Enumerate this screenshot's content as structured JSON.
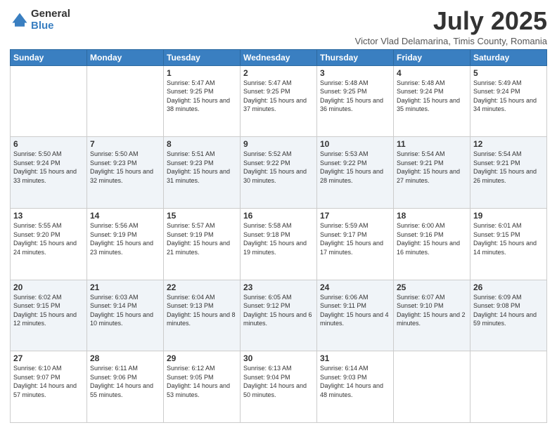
{
  "logo": {
    "general": "General",
    "blue": "Blue"
  },
  "title": "July 2025",
  "subtitle": "Victor Vlad Delamarina, Timis County, Romania",
  "days_of_week": [
    "Sunday",
    "Monday",
    "Tuesday",
    "Wednesday",
    "Thursday",
    "Friday",
    "Saturday"
  ],
  "weeks": [
    [
      {
        "day": "",
        "sunrise": "",
        "sunset": "",
        "daylight": ""
      },
      {
        "day": "",
        "sunrise": "",
        "sunset": "",
        "daylight": ""
      },
      {
        "day": "1",
        "sunrise": "Sunrise: 5:47 AM",
        "sunset": "Sunset: 9:25 PM",
        "daylight": "Daylight: 15 hours and 38 minutes."
      },
      {
        "day": "2",
        "sunrise": "Sunrise: 5:47 AM",
        "sunset": "Sunset: 9:25 PM",
        "daylight": "Daylight: 15 hours and 37 minutes."
      },
      {
        "day": "3",
        "sunrise": "Sunrise: 5:48 AM",
        "sunset": "Sunset: 9:25 PM",
        "daylight": "Daylight: 15 hours and 36 minutes."
      },
      {
        "day": "4",
        "sunrise": "Sunrise: 5:48 AM",
        "sunset": "Sunset: 9:24 PM",
        "daylight": "Daylight: 15 hours and 35 minutes."
      },
      {
        "day": "5",
        "sunrise": "Sunrise: 5:49 AM",
        "sunset": "Sunset: 9:24 PM",
        "daylight": "Daylight: 15 hours and 34 minutes."
      }
    ],
    [
      {
        "day": "6",
        "sunrise": "Sunrise: 5:50 AM",
        "sunset": "Sunset: 9:24 PM",
        "daylight": "Daylight: 15 hours and 33 minutes."
      },
      {
        "day": "7",
        "sunrise": "Sunrise: 5:50 AM",
        "sunset": "Sunset: 9:23 PM",
        "daylight": "Daylight: 15 hours and 32 minutes."
      },
      {
        "day": "8",
        "sunrise": "Sunrise: 5:51 AM",
        "sunset": "Sunset: 9:23 PM",
        "daylight": "Daylight: 15 hours and 31 minutes."
      },
      {
        "day": "9",
        "sunrise": "Sunrise: 5:52 AM",
        "sunset": "Sunset: 9:22 PM",
        "daylight": "Daylight: 15 hours and 30 minutes."
      },
      {
        "day": "10",
        "sunrise": "Sunrise: 5:53 AM",
        "sunset": "Sunset: 9:22 PM",
        "daylight": "Daylight: 15 hours and 28 minutes."
      },
      {
        "day": "11",
        "sunrise": "Sunrise: 5:54 AM",
        "sunset": "Sunset: 9:21 PM",
        "daylight": "Daylight: 15 hours and 27 minutes."
      },
      {
        "day": "12",
        "sunrise": "Sunrise: 5:54 AM",
        "sunset": "Sunset: 9:21 PM",
        "daylight": "Daylight: 15 hours and 26 minutes."
      }
    ],
    [
      {
        "day": "13",
        "sunrise": "Sunrise: 5:55 AM",
        "sunset": "Sunset: 9:20 PM",
        "daylight": "Daylight: 15 hours and 24 minutes."
      },
      {
        "day": "14",
        "sunrise": "Sunrise: 5:56 AM",
        "sunset": "Sunset: 9:19 PM",
        "daylight": "Daylight: 15 hours and 23 minutes."
      },
      {
        "day": "15",
        "sunrise": "Sunrise: 5:57 AM",
        "sunset": "Sunset: 9:19 PM",
        "daylight": "Daylight: 15 hours and 21 minutes."
      },
      {
        "day": "16",
        "sunrise": "Sunrise: 5:58 AM",
        "sunset": "Sunset: 9:18 PM",
        "daylight": "Daylight: 15 hours and 19 minutes."
      },
      {
        "day": "17",
        "sunrise": "Sunrise: 5:59 AM",
        "sunset": "Sunset: 9:17 PM",
        "daylight": "Daylight: 15 hours and 17 minutes."
      },
      {
        "day": "18",
        "sunrise": "Sunrise: 6:00 AM",
        "sunset": "Sunset: 9:16 PM",
        "daylight": "Daylight: 15 hours and 16 minutes."
      },
      {
        "day": "19",
        "sunrise": "Sunrise: 6:01 AM",
        "sunset": "Sunset: 9:15 PM",
        "daylight": "Daylight: 15 hours and 14 minutes."
      }
    ],
    [
      {
        "day": "20",
        "sunrise": "Sunrise: 6:02 AM",
        "sunset": "Sunset: 9:15 PM",
        "daylight": "Daylight: 15 hours and 12 minutes."
      },
      {
        "day": "21",
        "sunrise": "Sunrise: 6:03 AM",
        "sunset": "Sunset: 9:14 PM",
        "daylight": "Daylight: 15 hours and 10 minutes."
      },
      {
        "day": "22",
        "sunrise": "Sunrise: 6:04 AM",
        "sunset": "Sunset: 9:13 PM",
        "daylight": "Daylight: 15 hours and 8 minutes."
      },
      {
        "day": "23",
        "sunrise": "Sunrise: 6:05 AM",
        "sunset": "Sunset: 9:12 PM",
        "daylight": "Daylight: 15 hours and 6 minutes."
      },
      {
        "day": "24",
        "sunrise": "Sunrise: 6:06 AM",
        "sunset": "Sunset: 9:11 PM",
        "daylight": "Daylight: 15 hours and 4 minutes."
      },
      {
        "day": "25",
        "sunrise": "Sunrise: 6:07 AM",
        "sunset": "Sunset: 9:10 PM",
        "daylight": "Daylight: 15 hours and 2 minutes."
      },
      {
        "day": "26",
        "sunrise": "Sunrise: 6:09 AM",
        "sunset": "Sunset: 9:08 PM",
        "daylight": "Daylight: 14 hours and 59 minutes."
      }
    ],
    [
      {
        "day": "27",
        "sunrise": "Sunrise: 6:10 AM",
        "sunset": "Sunset: 9:07 PM",
        "daylight": "Daylight: 14 hours and 57 minutes."
      },
      {
        "day": "28",
        "sunrise": "Sunrise: 6:11 AM",
        "sunset": "Sunset: 9:06 PM",
        "daylight": "Daylight: 14 hours and 55 minutes."
      },
      {
        "day": "29",
        "sunrise": "Sunrise: 6:12 AM",
        "sunset": "Sunset: 9:05 PM",
        "daylight": "Daylight: 14 hours and 53 minutes."
      },
      {
        "day": "30",
        "sunrise": "Sunrise: 6:13 AM",
        "sunset": "Sunset: 9:04 PM",
        "daylight": "Daylight: 14 hours and 50 minutes."
      },
      {
        "day": "31",
        "sunrise": "Sunrise: 6:14 AM",
        "sunset": "Sunset: 9:03 PM",
        "daylight": "Daylight: 14 hours and 48 minutes."
      },
      {
        "day": "",
        "sunrise": "",
        "sunset": "",
        "daylight": ""
      },
      {
        "day": "",
        "sunrise": "",
        "sunset": "",
        "daylight": ""
      }
    ]
  ]
}
